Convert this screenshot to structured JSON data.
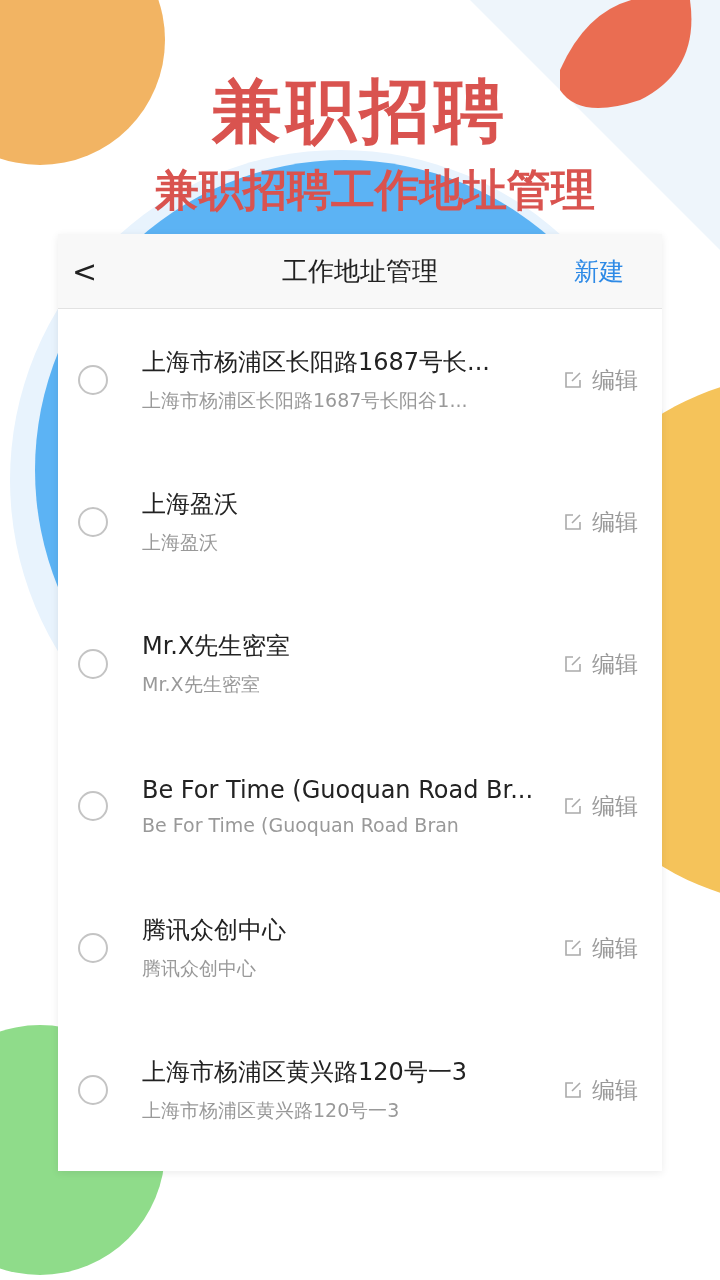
{
  "banner": {
    "title": "兼职招聘",
    "subtitle": "兼职招聘工作地址管理"
  },
  "header": {
    "back": "<",
    "title": "工作地址管理",
    "action": "新建"
  },
  "addresses": [
    {
      "name": "上海市杨浦区长阳路1687号长...",
      "detail": "上海市杨浦区长阳路1687号长阳谷1...",
      "edit": "编辑",
      "selected": false
    },
    {
      "name": "上海盈沃",
      "detail": "上海盈沃",
      "edit": "编辑",
      "selected": false
    },
    {
      "name": "Mr.X先生密室",
      "detail": "Mr.X先生密室",
      "edit": "编辑",
      "selected": false
    },
    {
      "name": "Be For Time (Guoquan Road Br...",
      "detail": "Be For Time (Guoquan Road Bran",
      "edit": "编辑",
      "selected": false
    },
    {
      "name": "腾讯众创中心",
      "detail": "腾讯众创中心",
      "edit": "编辑",
      "selected": false
    },
    {
      "name": "上海市杨浦区黄兴路120号一3",
      "detail": "上海市杨浦区黄兴路120号一3",
      "edit": "编辑",
      "selected": false
    }
  ]
}
